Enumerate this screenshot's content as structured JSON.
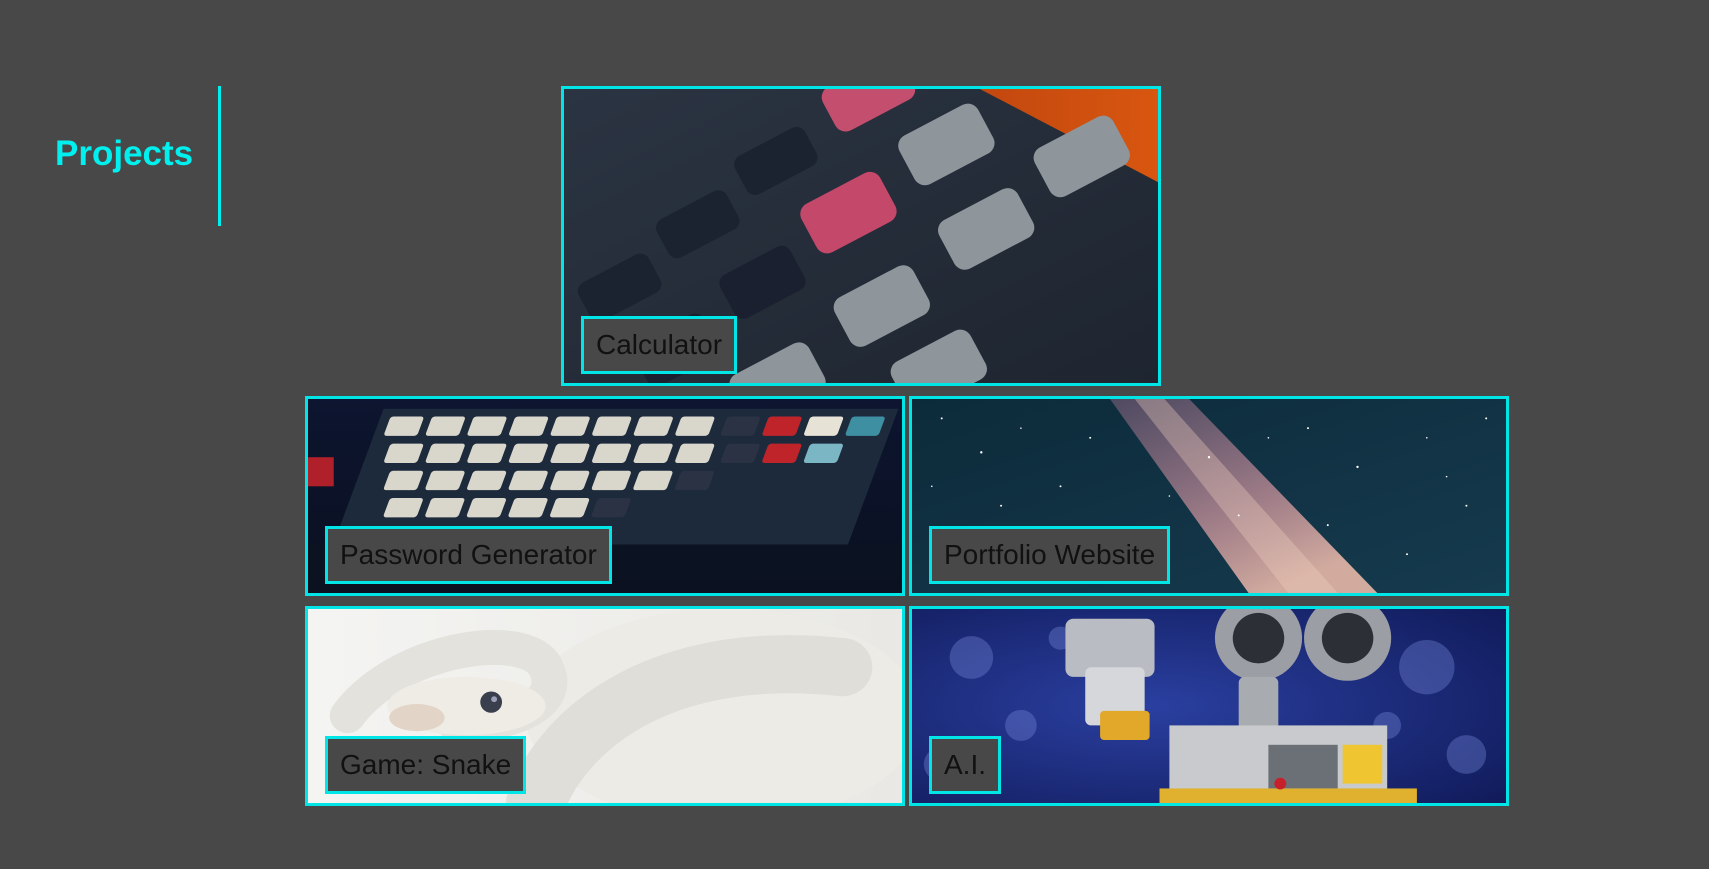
{
  "header": {
    "title": "Projects"
  },
  "projects": [
    {
      "label": "Calculator",
      "image_icon": "calculator-keys-image"
    },
    {
      "label": "Password Generator",
      "image_icon": "mechanical-keyboard-image"
    },
    {
      "label": "Portfolio Website",
      "image_icon": "milky-way-image"
    },
    {
      "label": "Game: Snake",
      "image_icon": "white-snake-image"
    },
    {
      "label": "A.I.",
      "image_icon": "robot-image"
    }
  ],
  "colors": {
    "accent": "#00f0f0",
    "background": "#484848",
    "label_text": "#111111"
  }
}
